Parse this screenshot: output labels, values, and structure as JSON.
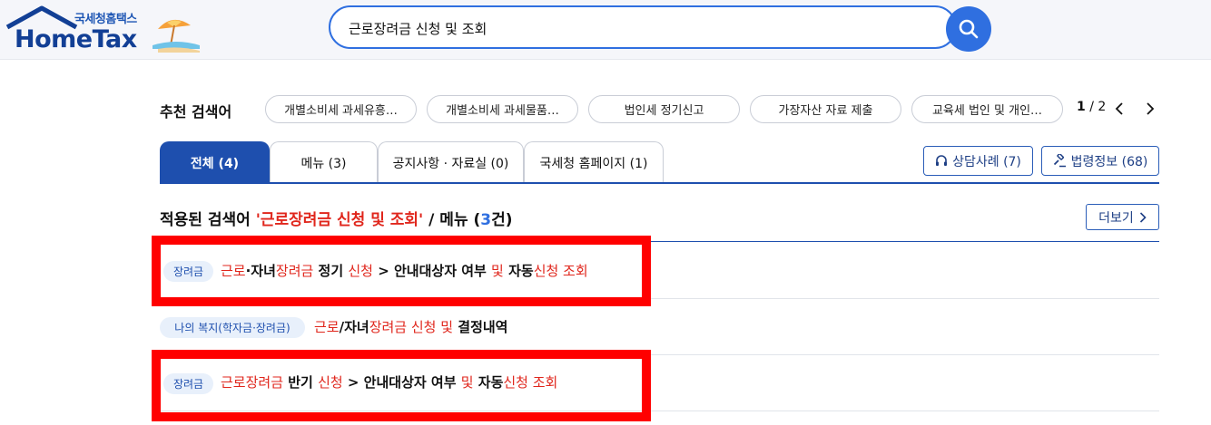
{
  "header": {
    "logo_sub": "국세청홈택스",
    "logo_main": "HomeTax",
    "search_value": "근로장려금 신청 및 조회"
  },
  "recommend": {
    "label": "추천 검색어",
    "chips": [
      "개별소비세 과세유흥…",
      "개별소비세 과세물품…",
      "법인세 정기신고",
      "가장자산 자료 제출",
      "교육세 법인 및 개인…"
    ],
    "page_current": "1",
    "page_sep": "/ 2"
  },
  "tabs": [
    {
      "label": "전체 (4)",
      "active": true
    },
    {
      "label": "메뉴 (3)",
      "active": false
    },
    {
      "label": "공지사항 · 자료실 (0)",
      "active": false
    },
    {
      "label": "국세청 홈페이지 (1)",
      "active": false
    }
  ],
  "side_buttons": {
    "consult": "상담사례 (7)",
    "law": "법령정보 (68)"
  },
  "applied": {
    "prefix": "적용된 검색어 ",
    "keyword": "'근로장려금 신청 및 조회'",
    "middle": " / 메뉴 (",
    "count": "3",
    "suffix": "건)",
    "more_label": "더보기"
  },
  "results": [
    {
      "badge": "장려금",
      "parts": [
        {
          "t": "근로",
          "hl": true
        },
        {
          "t": "·자녀",
          "hl": false
        },
        {
          "t": "장려금",
          "hl": true
        },
        {
          "t": " 정기 ",
          "hl": false
        },
        {
          "t": "신청",
          "hl": true
        },
        {
          "t": " > 안내대상자 여부 ",
          "hl": false
        },
        {
          "t": "및",
          "hl": true
        },
        {
          "t": " 자동",
          "hl": false
        },
        {
          "t": "신청 조회",
          "hl": true
        }
      ]
    },
    {
      "badge": "나의 복지(학자금·장려금)",
      "parts": [
        {
          "t": "근로",
          "hl": true
        },
        {
          "t": "/자녀",
          "hl": false
        },
        {
          "t": "장려금 신청 및",
          "hl": true
        },
        {
          "t": " 결정내역",
          "hl": false
        }
      ]
    },
    {
      "badge": "장려금",
      "parts": [
        {
          "t": "근로장려금",
          "hl": true
        },
        {
          "t": " 반기 ",
          "hl": false
        },
        {
          "t": "신청",
          "hl": true
        },
        {
          "t": " > 안내대상자 여부 ",
          "hl": false
        },
        {
          "t": "및",
          "hl": true
        },
        {
          "t": " 자동",
          "hl": false
        },
        {
          "t": "신청 조회",
          "hl": true
        }
      ]
    }
  ],
  "colors": {
    "brand_blue": "#1e4fae",
    "search_blue": "#2f6fe0",
    "highlight_red": "#e0261c",
    "annotation_red": "#ff0000"
  }
}
